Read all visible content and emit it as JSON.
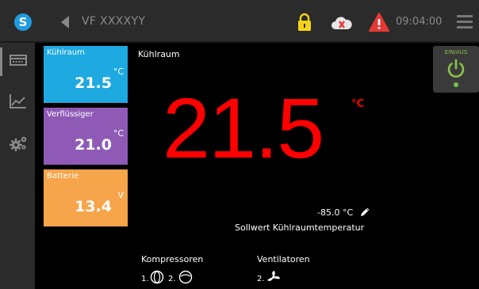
{
  "header": {
    "logo_letter": "S",
    "device_name": "VF XXXXYY",
    "time": "09:04:00"
  },
  "sidebar": {
    "items": [
      {
        "icon": "overview-icon"
      },
      {
        "icon": "chart-icon"
      },
      {
        "icon": "settings-gears-icon"
      }
    ]
  },
  "tiles": [
    {
      "label": "Kühlraum",
      "value": "21.5",
      "unit": "°C",
      "color": "#1ea9e1"
    },
    {
      "label": "Verflüssiger",
      "value": "21.0",
      "unit": "°C",
      "color": "#8e5ab6"
    },
    {
      "label": "Batterie",
      "value": "13.4",
      "unit": "V",
      "color": "#f7a54b"
    }
  ],
  "main": {
    "title": "Kühlraum",
    "value": "21.5",
    "unit": "°C",
    "setpoint": "-85.0 °C",
    "setpoint_label": "Sollwert Kühlraumtemperatur"
  },
  "power": {
    "label": "EIN/AUS"
  },
  "compressors": {
    "label": "Kompressoren",
    "items": [
      "1.",
      "2."
    ]
  },
  "fans": {
    "label": "Ventilatoren",
    "items": [
      "2."
    ]
  },
  "colors": {
    "accent_red": "#ff0000",
    "power_green": "#8bc34a",
    "lock_yellow": "#f5d21a",
    "alarm_red": "#e53935",
    "cloud_error": "#e53935"
  }
}
